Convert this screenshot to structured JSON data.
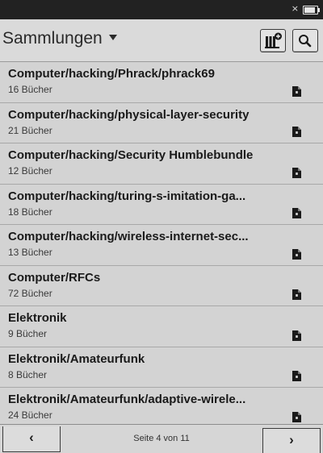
{
  "statusbar": {
    "close_glyph": "×",
    "battery_level": 0.85
  },
  "header": {
    "title": "Sammlungen",
    "dropdown_icon": "chevron-down-icon",
    "add_collection_icon": "library-add-icon",
    "search_icon": "search-icon"
  },
  "collections": [
    {
      "name": "Computer/hacking/Phrack/phrack69",
      "count": "16 Bücher"
    },
    {
      "name": "Computer/hacking/physical-layer-security",
      "count": "21 Bücher"
    },
    {
      "name": "Computer/hacking/Security Humblebundle",
      "count": "12 Bücher"
    },
    {
      "name": "Computer/hacking/turing-s-imitation-ga...",
      "count": "18 Bücher"
    },
    {
      "name": "Computer/hacking/wireless-internet-sec...",
      "count": "13 Bücher"
    },
    {
      "name": "Computer/RFCs",
      "count": "72 Bücher"
    },
    {
      "name": "Elektronik",
      "count": "9 Bücher"
    },
    {
      "name": "Elektronik/Amateurfunk",
      "count": "8 Bücher"
    },
    {
      "name": "Elektronik/Amateurfunk/adaptive-wirele...",
      "count": "24 Bücher"
    }
  ],
  "pagination": {
    "prev_label": "‹",
    "next_label": "›",
    "page_info": "Seite 4 von 11"
  }
}
